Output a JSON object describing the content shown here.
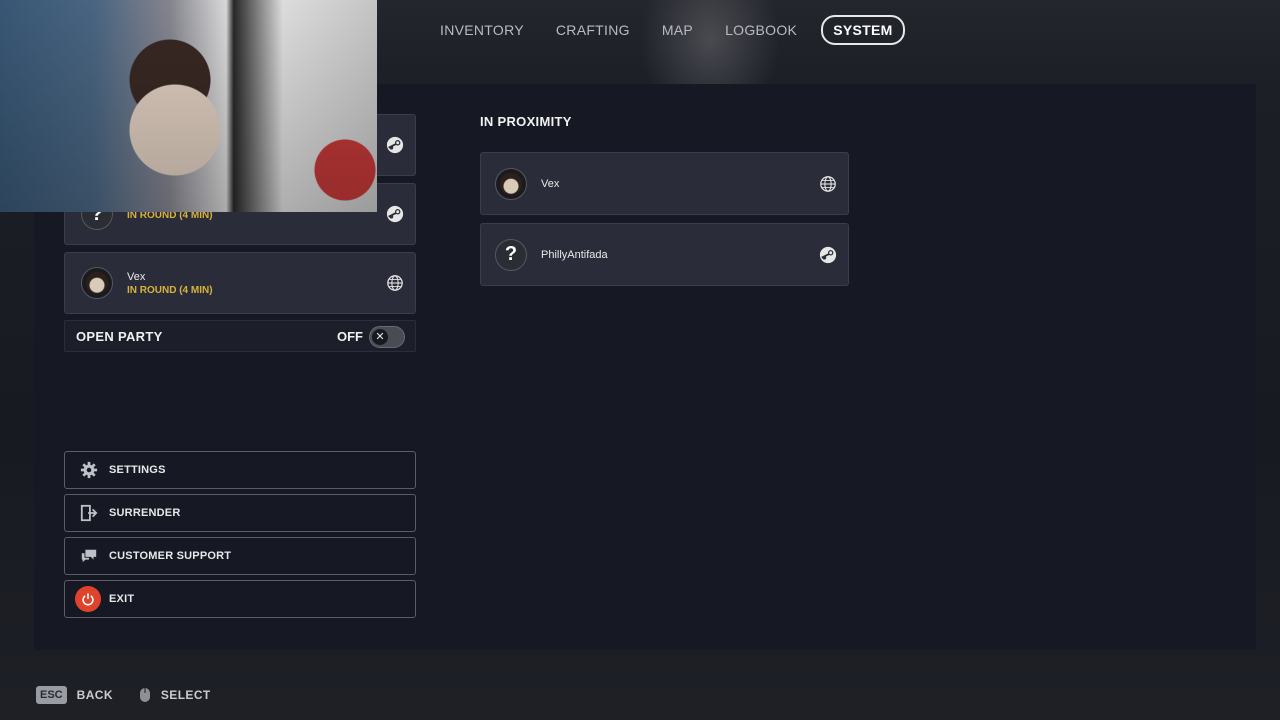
{
  "nav": {
    "tabs": [
      {
        "label": "INVENTORY"
      },
      {
        "label": "CRAFTING"
      },
      {
        "label": "MAP"
      },
      {
        "label": "LOGBOOK"
      },
      {
        "label": "SYSTEM",
        "active": true
      }
    ]
  },
  "party": {
    "members": [
      {
        "name": "",
        "status": "",
        "avatar": "unknown",
        "platform": "steam-icon"
      },
      {
        "name": "",
        "status": "IN ROUND (4 MIN)",
        "avatar": "unknown",
        "platform": "steam-icon"
      },
      {
        "name": "Vex",
        "status": "IN ROUND (4 MIN)",
        "avatar": "profile-picture",
        "platform": "globe-icon"
      }
    ],
    "open_party": {
      "label": "OPEN PARTY",
      "state": "OFF"
    }
  },
  "menu": {
    "settings": "SETTINGS",
    "surrender": "SURRENDER",
    "support": "CUSTOMER SUPPORT",
    "exit": "EXIT"
  },
  "proximity": {
    "title": "IN PROXIMITY",
    "players": [
      {
        "name": "Vex",
        "avatar": "profile-picture",
        "platform": "globe-icon"
      },
      {
        "name": "PhillyAntifada",
        "avatar": "unknown",
        "platform": "steam-icon"
      }
    ]
  },
  "footer": {
    "esc_key": "ESC",
    "back": "BACK",
    "select": "SELECT"
  },
  "colors": {
    "accent_status": "#d8b23a",
    "exit_red": "#e0432b",
    "background": "#161924"
  }
}
